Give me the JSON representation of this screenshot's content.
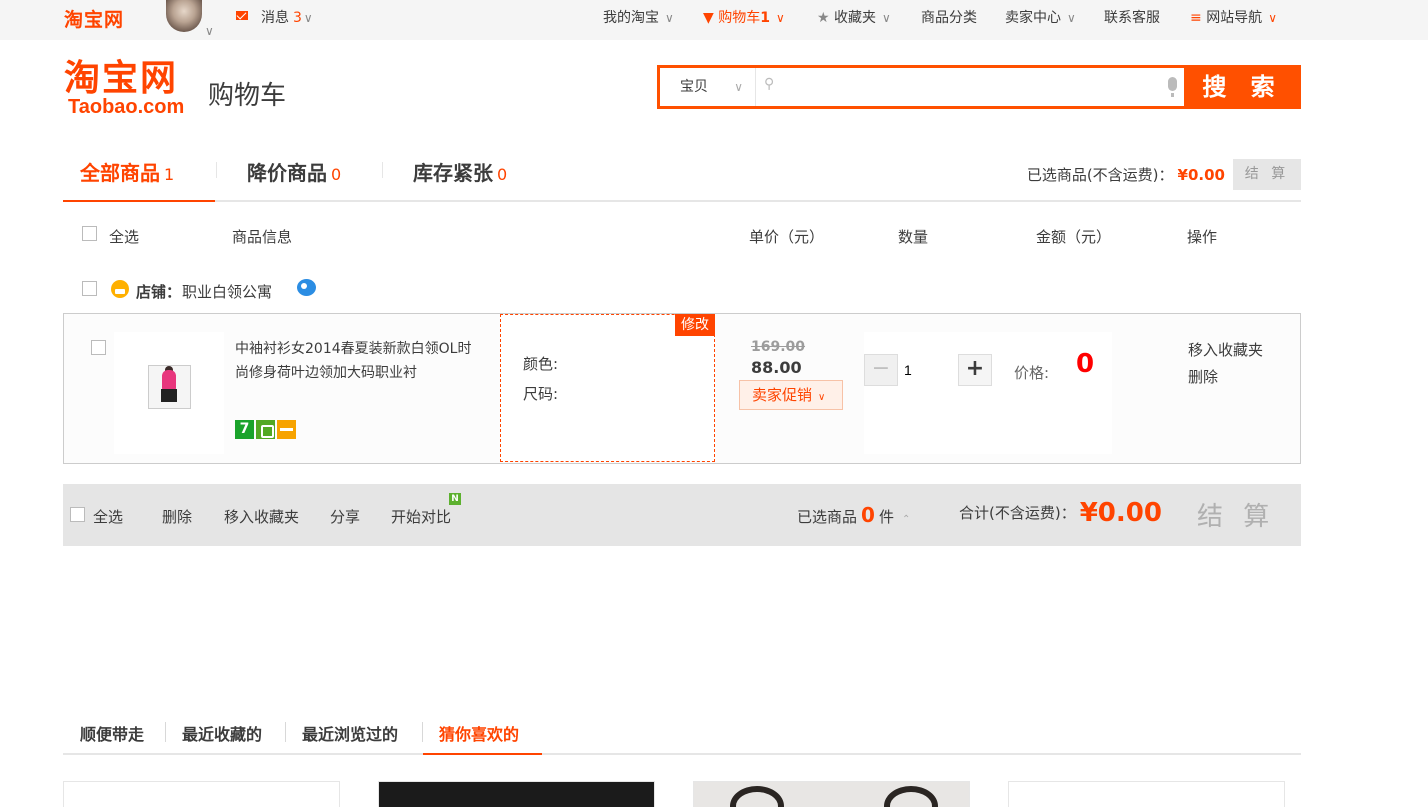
{
  "topbar": {
    "logo": "淘宝网",
    "messages_label": "消息",
    "messages_count": "3",
    "my_taobao": "我的淘宝",
    "cart_label": "购物车",
    "cart_count": "1",
    "favorites": "收藏夹",
    "categories": "商品分类",
    "seller_center": "卖家中心",
    "customer_service": "联系客服",
    "site_nav": "网站导航"
  },
  "header": {
    "logo_cn": "淘宝网",
    "logo_en": "Taobao.com",
    "page_title": "购物车"
  },
  "search": {
    "category": "宝贝",
    "placeholder": "",
    "button_label": "搜 索"
  },
  "tabs": [
    {
      "label": "全部商品",
      "count": "1"
    },
    {
      "label": "降价商品",
      "count": "0"
    },
    {
      "label": "库存紧张",
      "count": "0"
    }
  ],
  "selected_summary": {
    "label": "已选商品(不含运费)：",
    "amount": "¥0.00",
    "settle_label": "结 算"
  },
  "table_header": {
    "select_all": "全选",
    "product_info": "商品信息",
    "unit_price": "单价（元）",
    "quantity": "数量",
    "amount": "金额（元）",
    "operation": "操作"
  },
  "shop": {
    "prefix": "店铺：",
    "name": "职业白领公寓"
  },
  "item": {
    "title": "中袖衬衫女2014春夏装新款白领OL时尚修身荷叶边领加大码职业衬",
    "props_edit": "修改",
    "color_label": "颜色:",
    "size_label": "尺码:",
    "original_price": "169.00",
    "price": "88.00",
    "promo_label": "卖家促销",
    "quantity": "1",
    "price_label": "价格:",
    "price_value": "0",
    "op_move_favorite": "移入收藏夹",
    "op_delete": "删除",
    "badge_seven": "7"
  },
  "footer_bar": {
    "select_all": "全选",
    "delete": "删除",
    "move_favorite": "移入收藏夹",
    "share": "分享",
    "compare": "开始对比",
    "new_badge": "N",
    "selected_label": "已选商品",
    "selected_count": "0",
    "selected_unit": "件",
    "total_label": "合计(不含运费)：",
    "total_amount": "¥0.00",
    "settle_label": "结 算"
  },
  "bottom_tabs": [
    "顺便带走",
    "最近收藏的",
    "最近浏览过的",
    "猜你喜欢的"
  ],
  "colors": {
    "brand_orange": "#ff4400",
    "price_red": "#ff0000",
    "footer_gray": "#e5e5e5"
  }
}
